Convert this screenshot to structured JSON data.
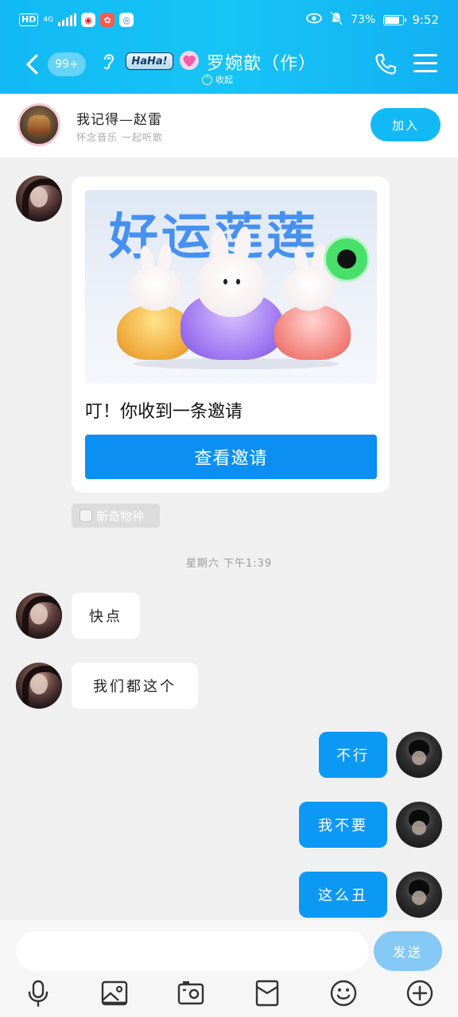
{
  "status_bar": {
    "hd": "HD",
    "network": "4G",
    "battery_percent": "73%",
    "battery_level": 0.73,
    "time": "9:52"
  },
  "header": {
    "unread_badge": "99+",
    "tag": "HaHa!",
    "title": "罗婉歆（作）",
    "collapse_label": "收起"
  },
  "group": {
    "name": "我记得—赵雷",
    "subtitle": "怀念音乐  一起听歌",
    "join_label": "加入"
  },
  "invite_card": {
    "image_heading": "好运莲莲",
    "sticker_text": "新奇物种",
    "message": "叮！你收到一条邀请",
    "button_label": "查看邀请",
    "source_label": "新奇物种"
  },
  "timestamp": "星期六 下午1:39",
  "messages": [
    {
      "from": "other",
      "text": "快点"
    },
    {
      "from": "other",
      "text": "我们都这个"
    },
    {
      "from": "me",
      "text": "不行"
    },
    {
      "from": "me",
      "text": "我不要"
    },
    {
      "from": "me",
      "text": "这么丑"
    }
  ],
  "input": {
    "placeholder": "",
    "send_label": "发送"
  },
  "toolbar": {
    "icons": [
      "microphone-icon",
      "image-icon",
      "camera-icon",
      "red-packet-icon",
      "emoji-icon",
      "plus-icon"
    ]
  },
  "colors": {
    "header": "#12b9f5",
    "bubble_out": "#0c99f5",
    "card_button": "#0c8ff3",
    "join_button": "#12b9f5",
    "send_button": "#86c9f7"
  }
}
